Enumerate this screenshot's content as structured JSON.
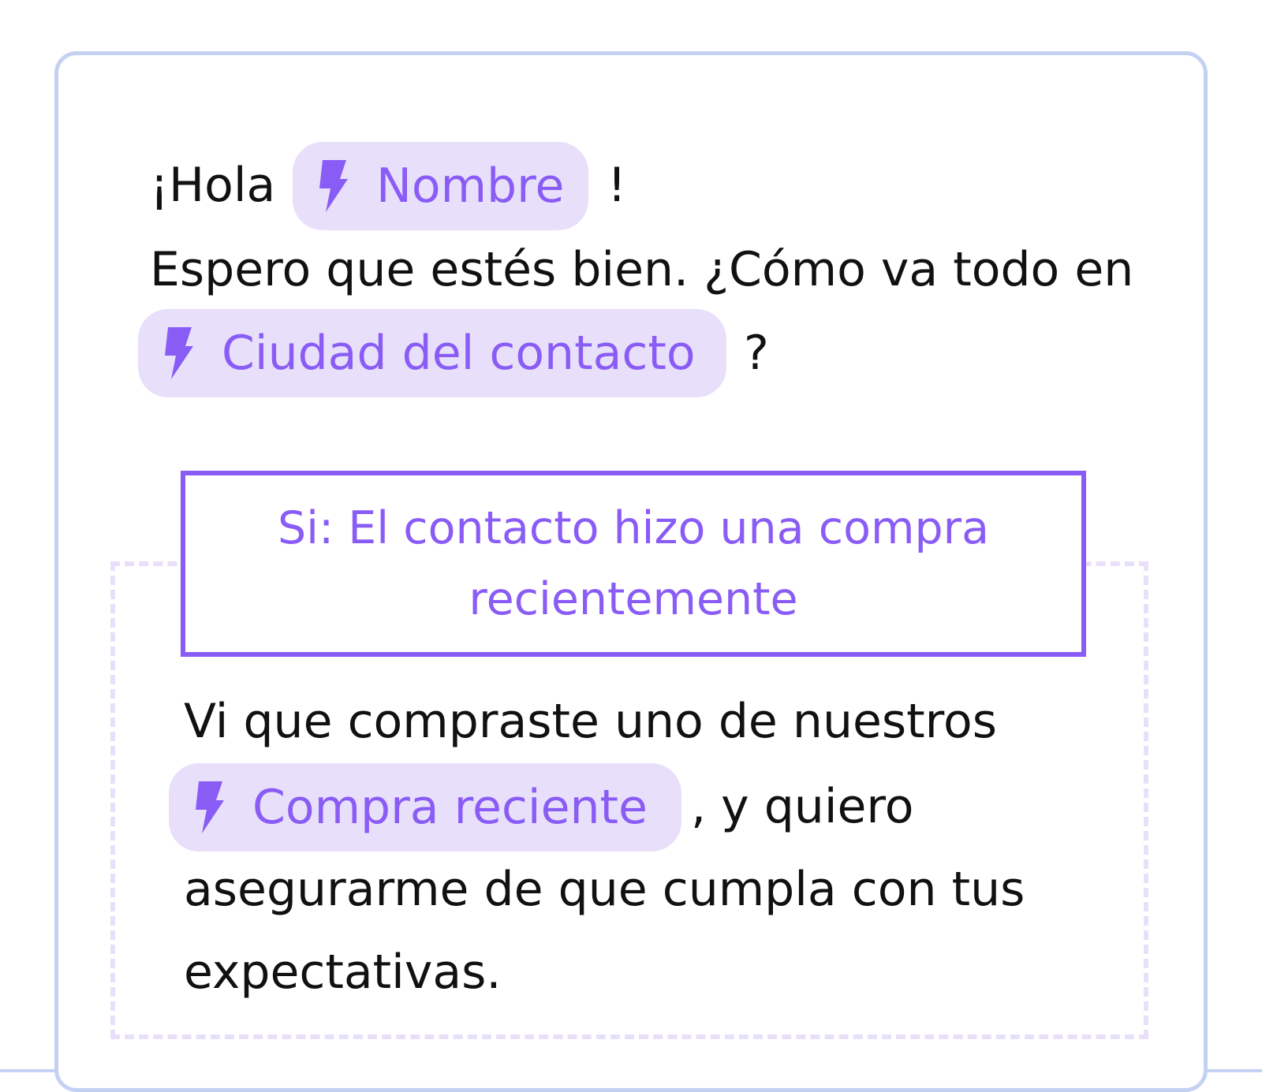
{
  "message": {
    "greeting_prefix": "¡Hola",
    "greeting_suffix": "!",
    "line2_text": "Espero que estés bien. ¿Cómo va todo en",
    "question_suffix": "?",
    "chips": {
      "nombre": "Nombre",
      "ciudad": "Ciudad del contacto",
      "compra": "Compra reciente"
    },
    "condition": {
      "label": "Si: El contacto hizo una compra recientemente"
    },
    "conditional_body": {
      "line1": "Vi que compraste uno de nuestros",
      "line2_suffix": ", y quiero",
      "line3": "asegurarme de que cumpla con tus",
      "line4": "expectativas."
    }
  },
  "colors": {
    "accent": "#8a5cf6",
    "chip_bg": "#e8e0fa",
    "card_border": "#c5d1f2",
    "dashed_border": "#e8e0fa",
    "text": "#111111"
  },
  "icons": {
    "chip_icon": "lightning-bolt-icon"
  }
}
